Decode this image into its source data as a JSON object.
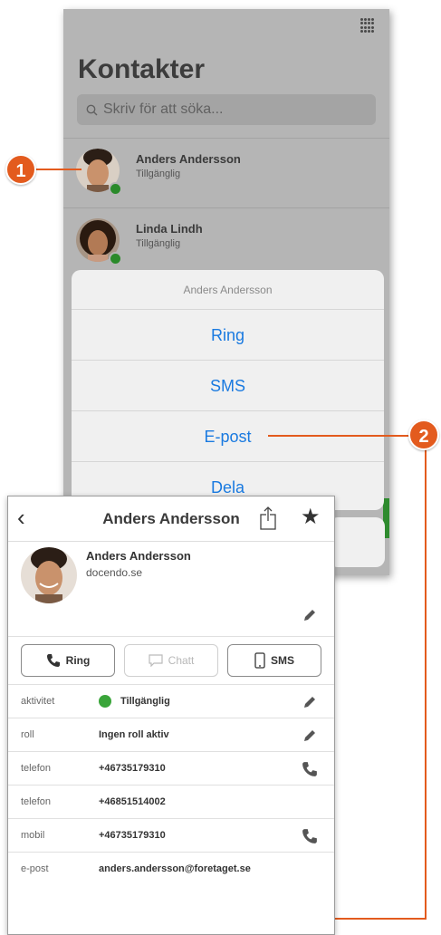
{
  "background_app": {
    "title": "Kontakter",
    "search_placeholder": "Skriv för att söka...",
    "contacts": [
      {
        "name": "Anders Andersson",
        "status": "Tillgänglig"
      },
      {
        "name": "Linda Lindh",
        "status": "Tillgänglig"
      }
    ]
  },
  "action_sheet": {
    "title": "Anders Andersson",
    "items": [
      "Ring",
      "SMS",
      "E-post",
      "Dela"
    ]
  },
  "callouts": [
    "1",
    "2"
  ],
  "contact_card": {
    "header_title": "Anders Andersson",
    "name": "Anders Andersson",
    "company": "docendo.se",
    "buttons": {
      "call": "Ring",
      "chat": "Chatt",
      "sms": "SMS"
    },
    "rows": [
      {
        "label": "aktivitet",
        "value": "Tillgänglig"
      },
      {
        "label": "roll",
        "value": "Ingen roll aktiv"
      },
      {
        "label": "telefon",
        "value": "+46735179310"
      },
      {
        "label": "telefon",
        "value": "+46851514002"
      },
      {
        "label": "mobil",
        "value": "+46735179310"
      },
      {
        "label": "e-post",
        "value": "anders.andersson@foretaget.se"
      }
    ]
  },
  "colors": {
    "accent": "#1a7ae0",
    "callout": "#e35b1e",
    "status_green": "#3aa53a"
  },
  "icons": [
    "grid-icon",
    "search-icon",
    "back-icon",
    "share-icon",
    "star-icon",
    "pencil-icon",
    "phone-icon",
    "chat-icon",
    "mobile-icon"
  ]
}
